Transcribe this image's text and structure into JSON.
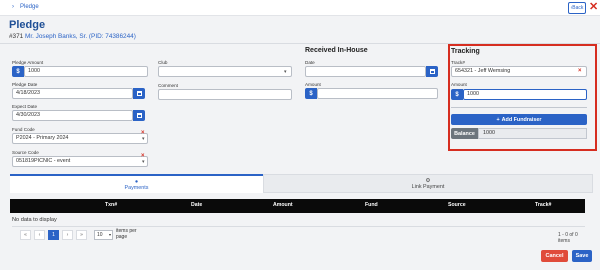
{
  "breadcrumb": {
    "label": "Pledge"
  },
  "header": {
    "back_label": "Back",
    "close_symbol": "✕",
    "title": "Pledge",
    "record_number": "#371",
    "donor_link": "Mr. Joseph Banks, Sr. (PID: 74386244)"
  },
  "form": {
    "pledge_amount": {
      "label": "Pledge Amount",
      "prefix": "$",
      "value": "1000"
    },
    "pledge_date": {
      "label": "Pledge Date",
      "value": "4/18/2023"
    },
    "expect_date": {
      "label": "Expect Date",
      "value": "4/30/2023"
    },
    "fund_code": {
      "label": "Fund Code",
      "value": "P2024 - Primary 2024"
    },
    "source_code": {
      "label": "Source Code",
      "value": "051819PICNIC - event"
    },
    "club": {
      "label": "Club",
      "value": ""
    },
    "comment": {
      "label": "Comment",
      "value": ""
    }
  },
  "received_in_house": {
    "title": "Received In-House",
    "date": {
      "label": "Date",
      "value": ""
    },
    "amount": {
      "label": "Amount",
      "prefix": "$",
      "value": ""
    }
  },
  "tracking": {
    "title": "Tracking",
    "track_label": "Track#",
    "track_value": "654321 - Jeff Wemsing",
    "amount_label": "Amount",
    "amount_prefix": "$",
    "amount_value": "1000",
    "add_fundraiser": "Add Fundraiser",
    "balance_label": "Balance",
    "balance_value": "1000"
  },
  "tabs": [
    {
      "label": "Payments",
      "icon": "person-icon",
      "active": true
    },
    {
      "label": "Link Payment",
      "icon": "link-icon",
      "active": false
    }
  ],
  "grid": {
    "columns": [
      "Txn#",
      "Date",
      "Amount",
      "Fund",
      "Source",
      "Track#"
    ],
    "empty_message": "No data to display",
    "pager": {
      "first": "«",
      "prev": "‹",
      "current_page": "1",
      "next": "›",
      "last": "»",
      "page_size": "10",
      "page_size_label": "items per page",
      "info": "1 - 0 of 0 items"
    }
  },
  "actions": {
    "cancel": "Cancel",
    "save": "Save"
  },
  "colors": {
    "accent": "#2b63c6",
    "danger": "#d62d20",
    "title": "#1f4f96"
  }
}
